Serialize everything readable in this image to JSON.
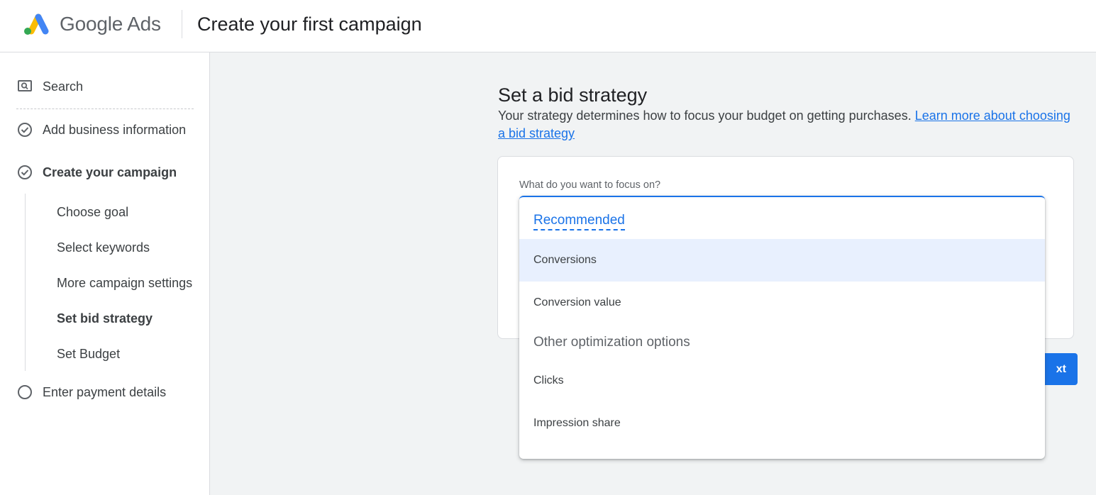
{
  "header": {
    "brand_google": "Google",
    "brand_ads": "Ads",
    "title": "Create your first campaign"
  },
  "sidebar": {
    "steps": [
      {
        "label": "Search",
        "icon": "search-box-icon"
      },
      {
        "label": "Add business information",
        "icon": "check-circle-icon"
      },
      {
        "label": "Create your campaign",
        "icon": "check-circle-icon"
      },
      {
        "label": "Enter payment details",
        "icon": "empty-circle-icon"
      }
    ],
    "substeps": [
      {
        "label": "Choose goal"
      },
      {
        "label": "Select keywords"
      },
      {
        "label": "More campaign settings"
      },
      {
        "label": "Set bid strategy"
      },
      {
        "label": "Set Budget"
      }
    ]
  },
  "main": {
    "title": "Set a bid strategy",
    "description": "Your strategy determines how to focus your budget on getting purchases.",
    "learn_more_link": "Learn more about choosing a bid strategy",
    "focus_label": "What do you want to focus on?",
    "next_label": "xt"
  },
  "dropdown": {
    "group_recommended": "Recommended",
    "recommended_options": [
      "Conversions",
      "Conversion value"
    ],
    "selected": "Conversions",
    "group_other": "Other optimization options",
    "other_options": [
      "Clicks",
      "Impression share"
    ]
  },
  "colors": {
    "accent": "#1a73e8",
    "selected_bg": "#e8f0fe",
    "main_bg": "#f1f3f4",
    "logo_blue": "#4285f4",
    "logo_yellow": "#fbbc04",
    "logo_green": "#34a853"
  }
}
